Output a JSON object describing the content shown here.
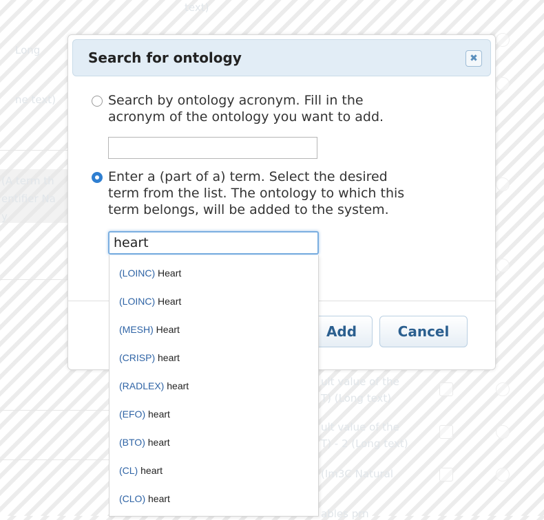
{
  "background": {
    "texts": [
      "Long",
      "ne text)",
      "(A term th",
      "entifier Na",
      "y",
      "text)",
      "ult value of the",
      "T) (Long text)",
      "ult value of the",
      "T) - 2 (Long text)",
      "(Im3C Natural",
      "ables prn"
    ]
  },
  "dialog": {
    "title": "Search for ontology",
    "close_icon": "close-icon",
    "option_acronym": {
      "line1": "Search by ontology acronym. Fill in the",
      "line2": "acronym of the ontology you want to add.",
      "selected": false
    },
    "acronym_input": {
      "value": "",
      "placeholder": ""
    },
    "option_term": {
      "line1": "Enter a (part of a) term. Select the desired",
      "line2": "term from the list. The ontology to which this",
      "line3": "term belongs, will be added to the system.",
      "selected": true
    },
    "term_input": {
      "value": "heart"
    },
    "buttons": {
      "add": "Add",
      "cancel": "Cancel"
    }
  },
  "autocomplete": {
    "items": [
      {
        "code": "(LOINC)",
        "term": "Heart"
      },
      {
        "code": "(LOINC)",
        "term": "Heart"
      },
      {
        "code": "(MESH)",
        "term": "Heart"
      },
      {
        "code": "(CRISP)",
        "term": "heart"
      },
      {
        "code": "(RADLEX)",
        "term": "heart"
      },
      {
        "code": "(EFO)",
        "term": "heart"
      },
      {
        "code": "(BTO)",
        "term": "heart"
      },
      {
        "code": "(CL)",
        "term": "heart"
      },
      {
        "code": "(CLO)",
        "term": "heart"
      }
    ]
  },
  "colors": {
    "accent": "#2f7fd1",
    "title_bar": "#e2edf6",
    "button_text": "#2b5f8f",
    "ontology_code": "#2e63a5"
  }
}
